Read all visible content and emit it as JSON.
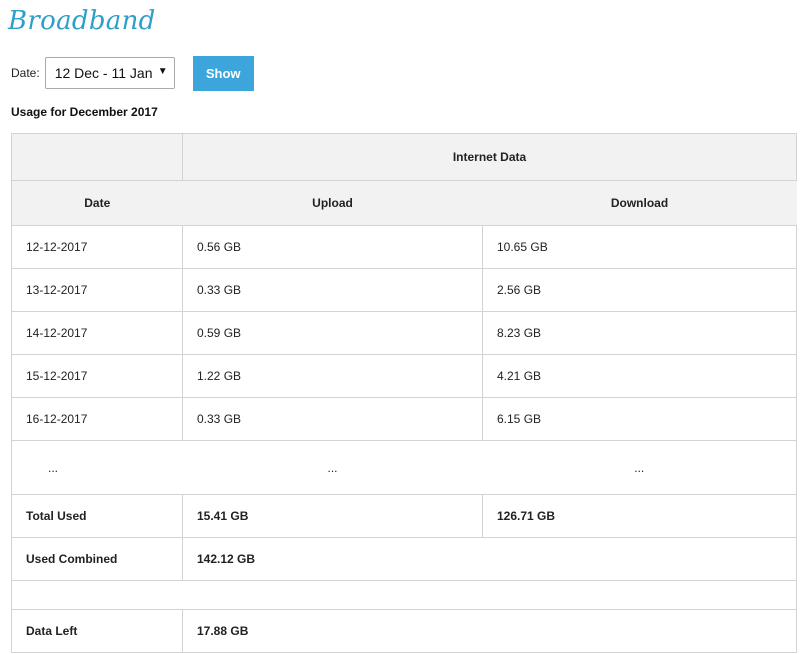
{
  "app": {
    "title": "Broadband"
  },
  "filter": {
    "date_label": "Date:",
    "selected_range": "12 Dec - 11 Jan",
    "show_label": "Show"
  },
  "usage": {
    "heading": "Usage for December 2017",
    "columns": {
      "group": "Internet Data",
      "date": "Date",
      "upload": "Upload",
      "download": "Download"
    },
    "rows": [
      {
        "date": "12-12-2017",
        "upload": "0.56 GB",
        "download": "10.65 GB"
      },
      {
        "date": "13-12-2017",
        "upload": "0.33 GB",
        "download": "2.56 GB"
      },
      {
        "date": "14-12-2017",
        "upload": "0.59 GB",
        "download": "8.23 GB"
      },
      {
        "date": "15-12-2017",
        "upload": "1.22 GB",
        "download": "4.21 GB"
      },
      {
        "date": "16-12-2017",
        "upload": "0.33 GB",
        "download": "6.15 GB"
      }
    ],
    "ellipsis": "...",
    "total": {
      "label": "Total Used",
      "upload": "15.41 GB",
      "download": "126.71 GB"
    },
    "combined": {
      "label": "Used Combined",
      "value": "142.12 GB"
    },
    "data_left": {
      "label": "Data Left",
      "value": "17.88 GB"
    }
  },
  "colors": {
    "title": "#2e9fc9",
    "button": "#3ba5dc",
    "header_bg": "#f2f2f2",
    "border": "#d3d3d3"
  }
}
